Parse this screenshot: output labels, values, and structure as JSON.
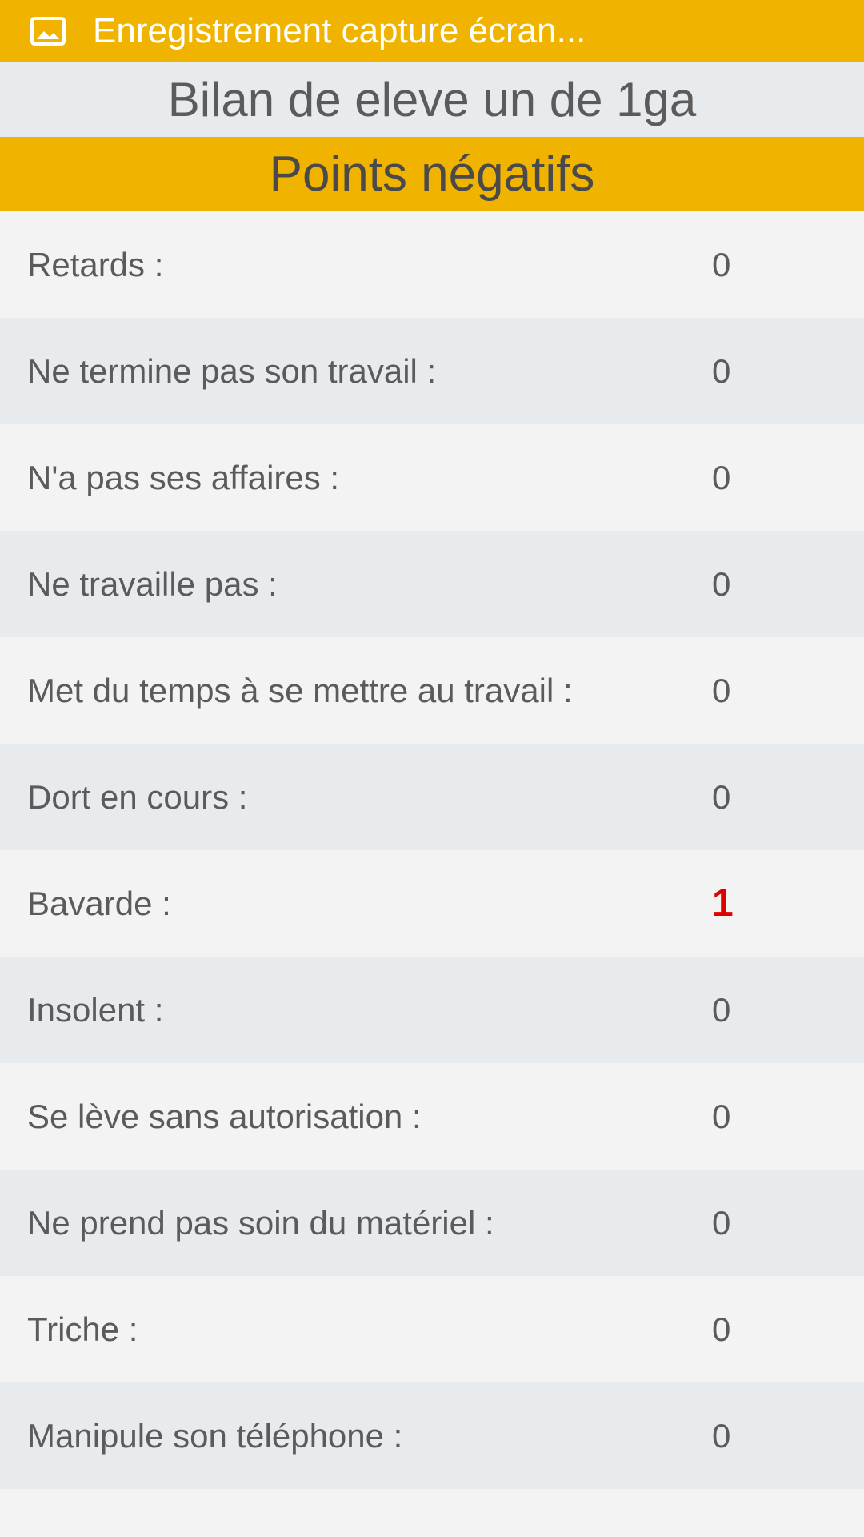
{
  "statusbar": {
    "icon": "image-icon",
    "text": "Enregistrement capture écran..."
  },
  "page": {
    "title": "Bilan de eleve un de 1ga",
    "section_header": "Points négatifs"
  },
  "colors": {
    "accent": "#f0b400",
    "highlight_value": "#e00000",
    "row_alt": "#e8ebee",
    "row_base": "#f3f3f3"
  },
  "rows": [
    {
      "label": "Retards :",
      "value": "0"
    },
    {
      "label": "Ne termine pas son travail :",
      "value": "0"
    },
    {
      "label": "N'a pas ses affaires :",
      "value": "0"
    },
    {
      "label": "Ne travaille pas :",
      "value": "0"
    },
    {
      "label": "Met du temps à se mettre au travail :",
      "value": "0"
    },
    {
      "label": "Dort en cours :",
      "value": "0"
    },
    {
      "label": "Bavarde :",
      "value": "1"
    },
    {
      "label": "Insolent :",
      "value": "0"
    },
    {
      "label": "Se lève sans autorisation :",
      "value": "0"
    },
    {
      "label": "Ne prend pas soin du matériel :",
      "value": "0"
    },
    {
      "label": "Triche :",
      "value": "0"
    },
    {
      "label": "Manipule son téléphone :",
      "value": "0"
    }
  ]
}
